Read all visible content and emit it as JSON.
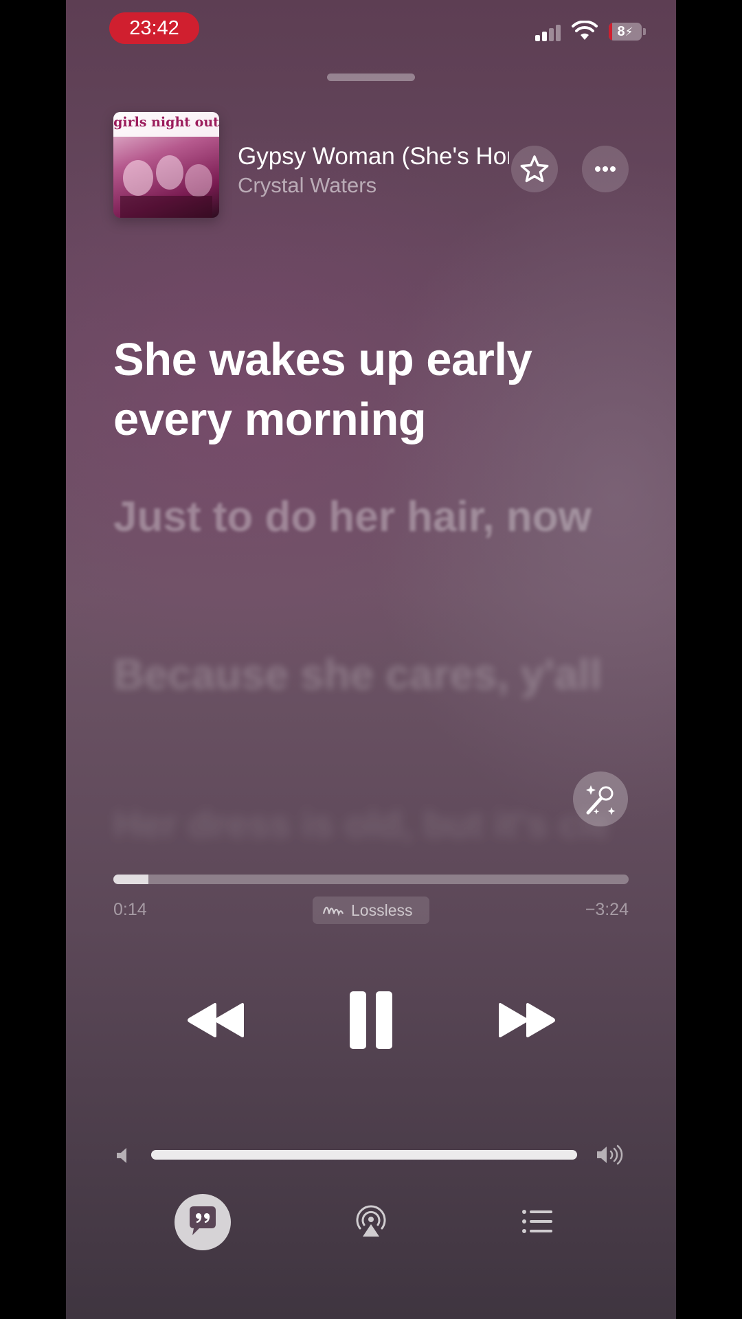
{
  "status_bar": {
    "time": "23:42",
    "battery": "8",
    "signal_bars": 2,
    "icons": [
      "cellular-signal-icon",
      "wifi-icon",
      "battery-charging-icon"
    ]
  },
  "now_playing": {
    "album_art_text": "girls night out",
    "title": "Gypsy Woman (She's Homeless)",
    "artist": "Crystal Waters",
    "favorite_icon": "star-icon",
    "more_icon": "ellipsis-icon"
  },
  "lyrics": {
    "current": "She wakes up early every morning",
    "next": "Just to do her hair, now",
    "after": "Because she cares, y'all",
    "faded": "Her dress is old, but it's clean"
  },
  "progress": {
    "elapsed": "0:14",
    "remaining": "−3:24",
    "fraction": 0.068,
    "badge": "Lossless"
  },
  "controls": {
    "rewind_icon": "rewind-icon",
    "pause_icon": "pause-icon",
    "forward_icon": "fast-forward-icon",
    "sing_icon": "microphone-sparkles-icon"
  },
  "volume": {
    "level": 1.0
  },
  "bottom_bar": {
    "lyrics_icon": "lyrics-quote-bubble-icon",
    "airplay_icon": "airplay-audio-icon",
    "queue_icon": "list-queue-icon"
  },
  "colors": {
    "clock_pill": "#d01f2f",
    "accent_text": "#ffffff"
  }
}
